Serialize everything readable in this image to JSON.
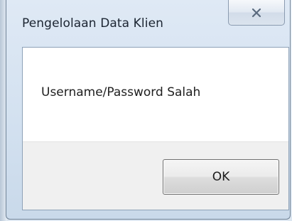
{
  "dialog": {
    "title": "Pengelolaan Data Klien",
    "message": "Username/Password Salah",
    "ok_label": "OK",
    "close_icon": "close-icon"
  }
}
